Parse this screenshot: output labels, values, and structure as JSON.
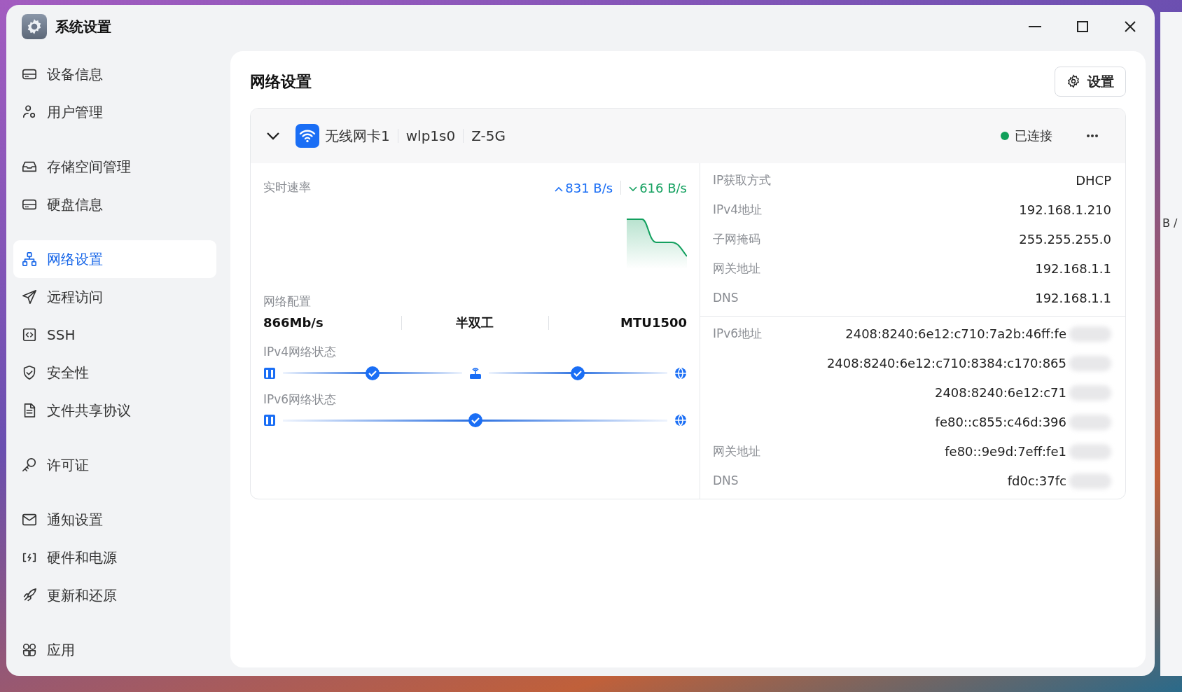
{
  "window": {
    "title": "系统设置"
  },
  "sidebar": {
    "groups": [
      {
        "items": [
          {
            "label": "设备信息",
            "selected": false
          },
          {
            "label": "用户管理",
            "selected": false
          }
        ]
      },
      {
        "items": [
          {
            "label": "存储空间管理",
            "selected": false
          },
          {
            "label": "硬盘信息",
            "selected": false
          }
        ]
      },
      {
        "items": [
          {
            "label": "网络设置",
            "selected": true
          },
          {
            "label": "远程访问",
            "selected": false
          },
          {
            "label": "SSH",
            "selected": false
          },
          {
            "label": "安全性",
            "selected": false
          },
          {
            "label": "文件共享协议",
            "selected": false
          }
        ]
      },
      {
        "items": [
          {
            "label": "许可证",
            "selected": false
          }
        ]
      },
      {
        "items": [
          {
            "label": "通知设置",
            "selected": false
          },
          {
            "label": "硬件和电源",
            "selected": false
          },
          {
            "label": "更新和还原",
            "selected": false
          }
        ]
      },
      {
        "items": [
          {
            "label": "应用",
            "selected": false
          }
        ]
      }
    ]
  },
  "page": {
    "title": "网络设置",
    "settings_button": "设置"
  },
  "adapter": {
    "expanded": true,
    "name": "无线网卡1",
    "interface": "wlp1s0",
    "ssid": "Z-5G",
    "status": {
      "label": "已连接",
      "color": "#10a05a"
    },
    "speed": {
      "label": "实时速率",
      "upload": "831 B/s",
      "download": "616 B/s"
    },
    "config": {
      "label": "网络配置",
      "values": [
        "866Mb/s",
        "半双工",
        "MTU1500"
      ]
    },
    "paths": [
      {
        "label": "IPv4网络状态",
        "nodes": [
          {
            "kind": "device"
          },
          {
            "kind": "link"
          },
          {
            "kind": "router"
          },
          {
            "kind": "link"
          },
          {
            "kind": "internet"
          }
        ]
      },
      {
        "label": "IPv6网络状态",
        "nodes": [
          {
            "kind": "device"
          },
          {
            "kind": "link"
          },
          {
            "kind": "internet"
          }
        ]
      }
    ],
    "ipv4": [
      {
        "label": "IP获取方式",
        "values": [
          "DHCP"
        ]
      },
      {
        "label": "IPv4地址",
        "values": [
          "192.168.1.210"
        ]
      },
      {
        "label": "子网掩码",
        "values": [
          "255.255.255.0"
        ]
      },
      {
        "label": "网关地址",
        "values": [
          "192.168.1.1"
        ]
      },
      {
        "label": "DNS",
        "values": [
          "192.168.1.1"
        ]
      }
    ],
    "ipv6": [
      {
        "label": "IPv6地址",
        "values": [
          "2408:8240:6e12:c710:7a2b:46ff:fe",
          "2408:8240:6e12:c710:8384:c170:865",
          "2408:8240:6e12:c71",
          "fe80::c855:c46d:396"
        ],
        "redacted": true
      },
      {
        "label": "网关地址",
        "values": [
          "fe80::9e9d:7eff:fe1"
        ],
        "redacted": true
      },
      {
        "label": "DNS",
        "values": [
          "fd0c:37fc"
        ],
        "redacted": true
      }
    ]
  },
  "background_window": {
    "text": "B /"
  }
}
